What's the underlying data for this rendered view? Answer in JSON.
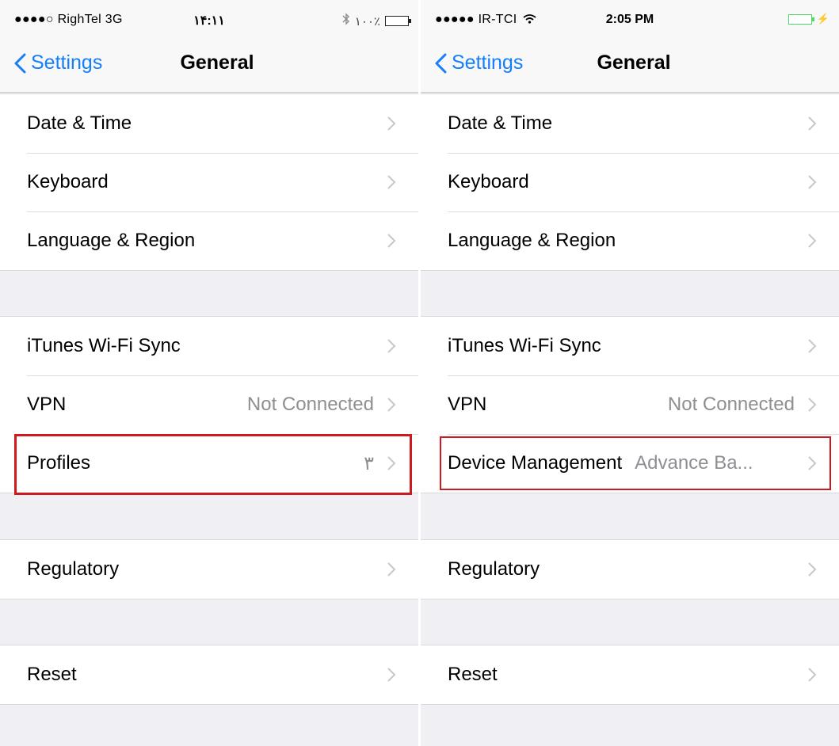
{
  "left": {
    "status": {
      "carrier": "●●●●○ RighTel  3G",
      "time": "۱۴:۱۱",
      "battery_text": "۱۰۰٪"
    },
    "nav": {
      "back_label": "Settings",
      "title": "General"
    },
    "groups": [
      [
        {
          "label": "Date & Time",
          "value": ""
        },
        {
          "label": "Keyboard",
          "value": ""
        },
        {
          "label": "Language & Region",
          "value": ""
        }
      ],
      [
        {
          "label": "iTunes Wi-Fi Sync",
          "value": ""
        },
        {
          "label": "VPN",
          "value": "Not Connected"
        },
        {
          "label": "Profiles",
          "value": "۳"
        }
      ],
      [
        {
          "label": "Regulatory",
          "value": ""
        }
      ],
      [
        {
          "label": "Reset",
          "value": ""
        }
      ]
    ]
  },
  "right": {
    "status": {
      "carrier": "●●●●● IR-TCI",
      "time": "2:05 PM"
    },
    "nav": {
      "back_label": "Settings",
      "title": "General"
    },
    "groups": [
      [
        {
          "label": "Date & Time",
          "value": ""
        },
        {
          "label": "Keyboard",
          "value": ""
        },
        {
          "label": "Language & Region",
          "value": ""
        }
      ],
      [
        {
          "label": "iTunes Wi-Fi Sync",
          "value": ""
        },
        {
          "label": "VPN",
          "value": "Not Connected"
        },
        {
          "label": "Device Management",
          "value": "Advance Ba..."
        }
      ],
      [
        {
          "label": "Regulatory",
          "value": ""
        }
      ],
      [
        {
          "label": "Reset",
          "value": ""
        }
      ]
    ]
  },
  "colors": {
    "accent": "#147efb",
    "highlight": "#d0191e",
    "secondary_text": "#8e8e93",
    "background": "#efeff4",
    "battery_charging": "#4cd964"
  },
  "icons": [
    "back-chevron-icon",
    "disclosure-chevron-icon",
    "bluetooth-icon",
    "wifi-icon",
    "battery-icon",
    "charging-bolt-icon"
  ]
}
